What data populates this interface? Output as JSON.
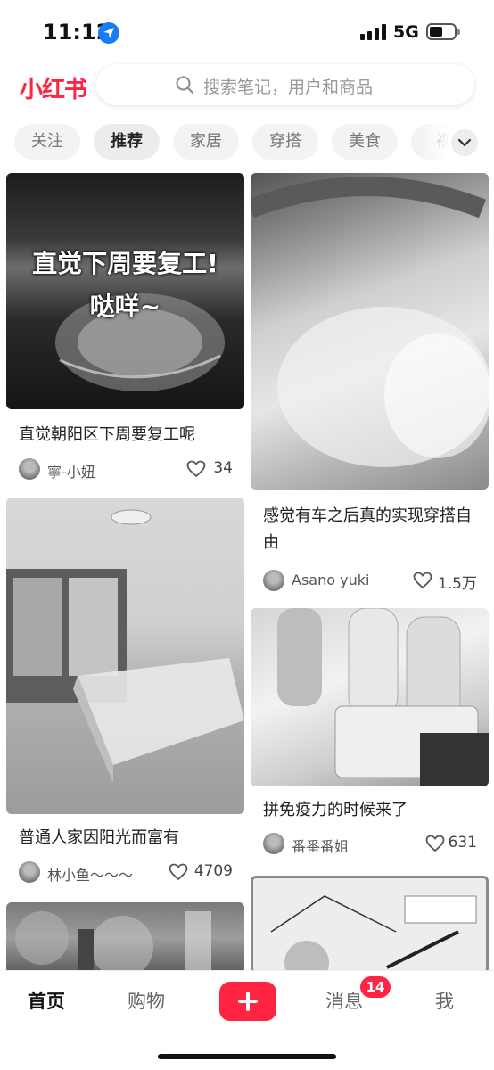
{
  "status": {
    "time": "11:12",
    "network": "5G"
  },
  "header": {
    "logo": "小红书",
    "search_placeholder": "搜索笔记，用户和商品"
  },
  "tabs": [
    "关注",
    "推荐",
    "家居",
    "穿搭",
    "美食",
    "视"
  ],
  "active_tab": "推荐",
  "feed": [
    {
      "image_text_line1": "直觉下周要复工!",
      "image_text_line2": "哒咩~",
      "title": "直觉朝阳区下周要复工呢",
      "author": "寧-小妞",
      "likes": "34"
    },
    {
      "title": "感觉有车之后真的实现穿搭自由",
      "author": "Asano yuki",
      "likes": "1.5万"
    },
    {
      "title": "普通人家因阳光而富有",
      "author": "林小鱼～～～",
      "likes": "4709"
    },
    {
      "title": "拼免疫力的时候来了",
      "author": "番番番姐",
      "likes": "631"
    }
  ],
  "bottom_nav": {
    "home": "首页",
    "shop": "购物",
    "messages": "消息",
    "messages_badge": "14",
    "me": "我"
  },
  "colors": {
    "brand": "#ff2442",
    "accent_location": "#1a7cf5"
  },
  "icons": [
    "location-arrow-icon",
    "signal-icon",
    "battery-icon",
    "search-icon",
    "chevron-down-icon",
    "heart-icon",
    "plus-icon"
  ]
}
